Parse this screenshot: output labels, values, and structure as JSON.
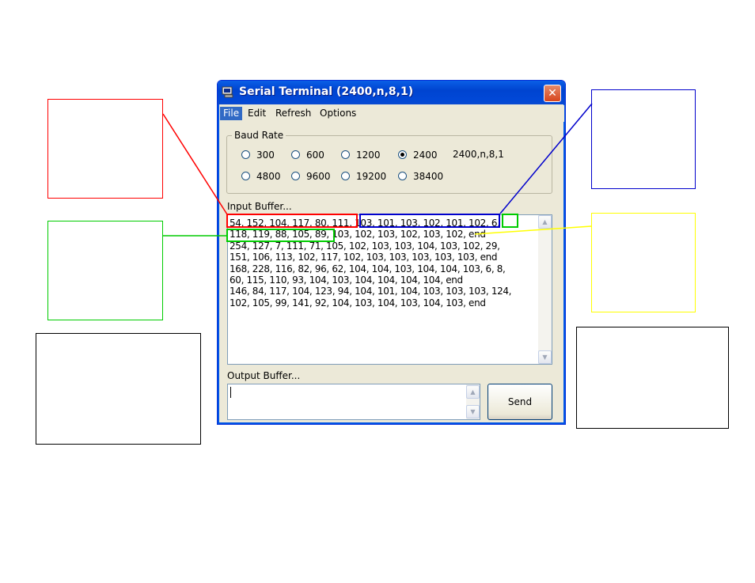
{
  "window": {
    "title": "Serial Terminal (2400,n,8,1)",
    "close_glyph": "✕"
  },
  "menu": [
    "File",
    "Edit",
    "Refresh",
    "Options"
  ],
  "baud": {
    "legend": "Baud Rate",
    "options": [
      "300",
      "600",
      "1200",
      "2400",
      "4800",
      "9600",
      "19200",
      "38400"
    ],
    "selected": "2400",
    "status": "2400,n,8,1"
  },
  "input": {
    "label": "Input Buffer...",
    "lines": [
      "54, 152, 104, 117, 80, 111, 103, 101, 103, 102, 101, 102, 6,",
      "118, 119, 88, 105, 89, 103, 102, 103, 102, 103, 102, end",
      "254, 127, 7, 111, 71, 105, 102, 103, 103, 104, 103, 102, 29,",
      "151, 106, 113, 102, 117, 102, 103, 103, 103, 103, 103, end",
      "168, 228, 116, 82, 96, 62, 104, 104, 103, 104, 104, 103, 6, 8,",
      "60, 115, 110, 93, 104, 103, 104, 104, 104, 104, end",
      "146, 84, 117, 104, 123, 94, 104, 101, 104, 103, 103, 103, 124,",
      "102, 105, 99, 141, 92, 104, 103, 104, 103, 104, 103, end"
    ]
  },
  "output": {
    "label": "Output Buffer...",
    "value": ""
  },
  "send_label": "Send",
  "annotation_colors": {
    "red": "#ff0000",
    "blue": "#0000cc",
    "green": "#00cc00",
    "yellow": "#ffff00",
    "black": "#000000"
  }
}
